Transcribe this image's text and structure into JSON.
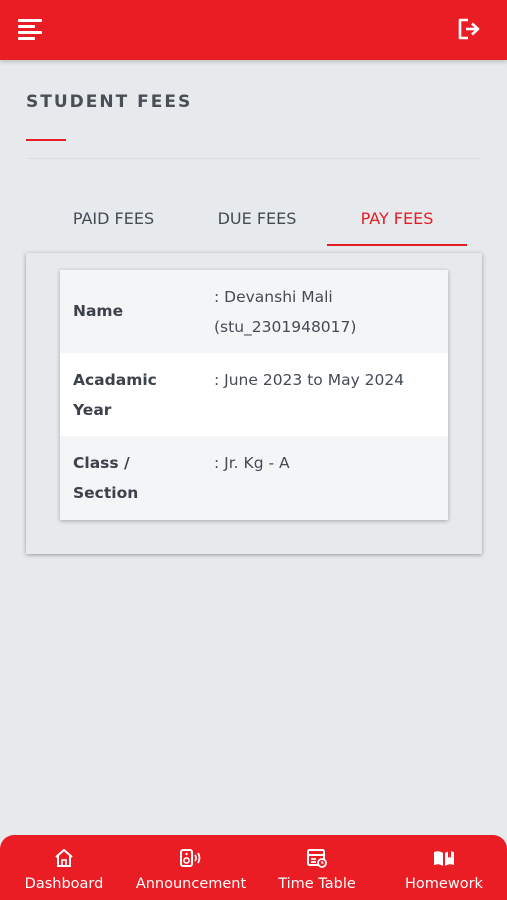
{
  "header": {
    "menu_icon": "hamburger-menu-icon",
    "logout_icon": "logout-icon",
    "accent_color": "#ea1c24"
  },
  "page": {
    "title": "STUDENT FEES"
  },
  "tabs": [
    {
      "label": "PAID FEES",
      "active": false
    },
    {
      "label": "DUE FEES",
      "active": false
    },
    {
      "label": "PAY FEES",
      "active": true
    }
  ],
  "student_info": [
    {
      "label": "Name",
      "value": ": Devanshi Mali (stu_2301948017)"
    },
    {
      "label": "Acadamic Year",
      "value": ": June 2023 to May 2024"
    },
    {
      "label": "Class / Section",
      "value": ": Jr. Kg - A"
    }
  ],
  "bottom_nav": [
    {
      "label": "Dashboard",
      "icon": "home-icon"
    },
    {
      "label": "Announcement",
      "icon": "speaker-icon"
    },
    {
      "label": "Time Table",
      "icon": "timetable-icon"
    },
    {
      "label": "Homework",
      "icon": "book-icon"
    }
  ]
}
